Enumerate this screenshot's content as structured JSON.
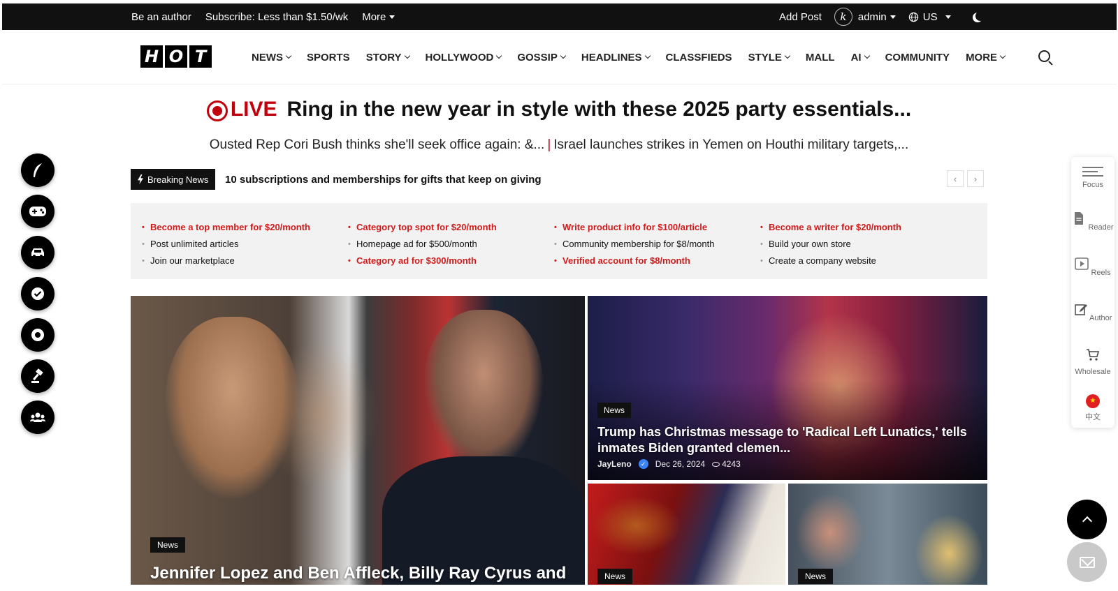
{
  "topbar": {
    "be_author": "Be an author",
    "subscribe": "Subscribe: Less than $1.50/wk",
    "more": "More",
    "add_post": "Add Post",
    "avatar_letter": "k",
    "user": "admin",
    "locale": "US"
  },
  "logo": [
    "H",
    "O",
    "T"
  ],
  "nav": {
    "items": [
      {
        "label": "NEWS",
        "dropdown": true
      },
      {
        "label": "SPORTS",
        "dropdown": false
      },
      {
        "label": "STORY",
        "dropdown": true
      },
      {
        "label": "HOLLYWOOD",
        "dropdown": true
      },
      {
        "label": "GOSSIP",
        "dropdown": true
      },
      {
        "label": "HEADLINES",
        "dropdown": true
      },
      {
        "label": "CLASSFIEDS",
        "dropdown": false
      },
      {
        "label": "STYLE",
        "dropdown": true
      },
      {
        "label": "MALL",
        "dropdown": false
      },
      {
        "label": "AI",
        "dropdown": true
      },
      {
        "label": "COMMUNITY",
        "dropdown": false
      },
      {
        "label": "MORE",
        "dropdown": true
      }
    ]
  },
  "live": {
    "label": "LIVE",
    "headline": "Ring in the new year in style with these 2025 party essentials...",
    "sub1": "Ousted Rep Cori Bush thinks she'll seek office again: &...",
    "sep": "|",
    "sub2": "Israel launches strikes in Yemen on Houthi military targets,..."
  },
  "breaking": {
    "label": "Breaking News",
    "text": "10 subscriptions and memberships for gifts that keep on giving",
    "prev": "‹",
    "next": "›"
  },
  "ads": {
    "columns": [
      [
        {
          "text": "Become a top member for $20/month",
          "highlight": true
        },
        {
          "text": "Post unlimited articles",
          "highlight": false
        },
        {
          "text": "Join our marketplace",
          "highlight": false
        }
      ],
      [
        {
          "text": "Category top spot for $20/month",
          "highlight": true
        },
        {
          "text": "Homepage ad for $500/month",
          "highlight": false
        },
        {
          "text": "Category ad for $300/month",
          "highlight": true
        }
      ],
      [
        {
          "text": "Write product info for $100/article",
          "highlight": true
        },
        {
          "text": "Community membership for $8/month",
          "highlight": false
        },
        {
          "text": "Verified account for $8/month",
          "highlight": true
        }
      ],
      [
        {
          "text": "Become a writer for $20/month",
          "highlight": true
        },
        {
          "text": "Build your own store",
          "highlight": false
        },
        {
          "text": "Create a company website",
          "highlight": false
        }
      ]
    ]
  },
  "cards": {
    "main": {
      "tag": "News",
      "title": "Jennifer Lopez and Ben Affleck, Billy Ray Cyrus and"
    },
    "second": {
      "tag": "News",
      "title": "Trump has Christmas message to 'Radical Left Lunatics,' tells inmates Biden granted clemen...",
      "author": "JayLeno",
      "date": "Dec 26, 2024",
      "views": "4243"
    },
    "third": {
      "tag": "News"
    },
    "fourth": {
      "tag": "News"
    }
  },
  "left_icons": [
    "feather-icon",
    "gamepad-icon",
    "car-icon",
    "badge-check-icon",
    "sport-ball-icon",
    "auction-gavel-icon",
    "group-icon"
  ],
  "right_panel": {
    "focus": "Focus",
    "reader": "Reader",
    "reels": "Reels",
    "author": "Author",
    "wholesale": "Wholesale",
    "language": "中文"
  },
  "colors": {
    "accent_red": "#c0000c",
    "highlight_red": "#d11b1b",
    "topbar_bg": "#111111"
  }
}
